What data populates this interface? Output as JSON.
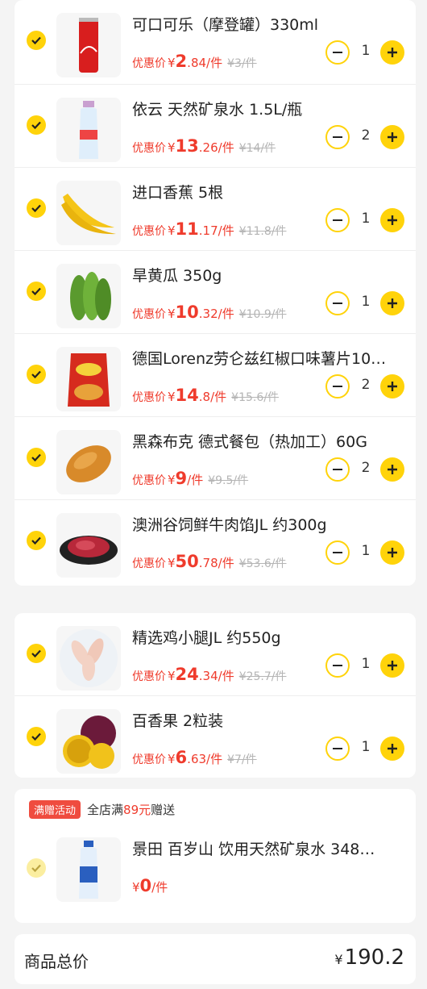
{
  "cart_group_1": [
    {
      "name": "可口可乐（摩登罐）330ml",
      "price_label": "优惠价",
      "cur": "¥",
      "price_int": "2",
      "price_dec": ".84",
      "unit": "/件",
      "orig": "¥3/件",
      "qty": "1"
    },
    {
      "name": "依云 天然矿泉水 1.5L/瓶",
      "price_label": "优惠价",
      "cur": "¥",
      "price_int": "13",
      "price_dec": ".26",
      "unit": "/件",
      "orig": "¥14/件",
      "qty": "2"
    },
    {
      "name": "进口香蕉 5根",
      "price_label": "优惠价",
      "cur": "¥",
      "price_int": "11",
      "price_dec": ".17",
      "unit": "/件",
      "orig": "¥11.8/件",
      "qty": "1"
    },
    {
      "name": "旱黄瓜 350g",
      "price_label": "优惠价",
      "cur": "¥",
      "price_int": "10",
      "price_dec": ".32",
      "unit": "/件",
      "orig": "¥10.9/件",
      "qty": "1"
    },
    {
      "name": "德国Lorenz劳仑兹红椒口味薯片10…",
      "price_label": "优惠价",
      "cur": "¥",
      "price_int": "14",
      "price_dec": ".8",
      "unit": "/件",
      "orig": "¥15.6/件",
      "qty": "2"
    },
    {
      "name": "黑森布克 德式餐包（热加工）60G",
      "price_label": "优惠价",
      "cur": "¥",
      "price_int": "9",
      "price_dec": "",
      "unit": "/件",
      "orig": "¥9.5/件",
      "qty": "2"
    },
    {
      "name": "澳洲谷饲鲜牛肉馅JL 约300g",
      "price_label": "优惠价",
      "cur": "¥",
      "price_int": "50",
      "price_dec": ".78",
      "unit": "/件",
      "orig": "¥53.6/件",
      "qty": "1"
    }
  ],
  "cart_group_2": [
    {
      "name": "精选鸡小腿JL 约550g",
      "price_label": "优惠价",
      "cur": "¥",
      "price_int": "24",
      "price_dec": ".34",
      "unit": "/件",
      "orig": "¥25.7/件",
      "qty": "1"
    },
    {
      "name": "百香果 2粒装",
      "price_label": "优惠价",
      "cur": "¥",
      "price_int": "6",
      "price_dec": ".63",
      "unit": "/件",
      "orig": "¥7/件",
      "qty": "1"
    }
  ],
  "promotion": {
    "tag": "满赠活动",
    "text_before": "全店满",
    "amount": "89元",
    "text_after": "赠送",
    "gift_name": "景田 百岁山 饮用天然矿泉水 348…",
    "gift_cur": "¥",
    "gift_price": "0",
    "gift_unit": "/件"
  },
  "total": {
    "label": "商品总价",
    "cur": "¥",
    "value": "190.2"
  },
  "colors": {
    "accent": "#ffd30a",
    "price": "#ef3b2c",
    "tag": "#ef4c3f"
  },
  "icons": [
    "check-icon",
    "minus-icon",
    "plus-icon"
  ]
}
